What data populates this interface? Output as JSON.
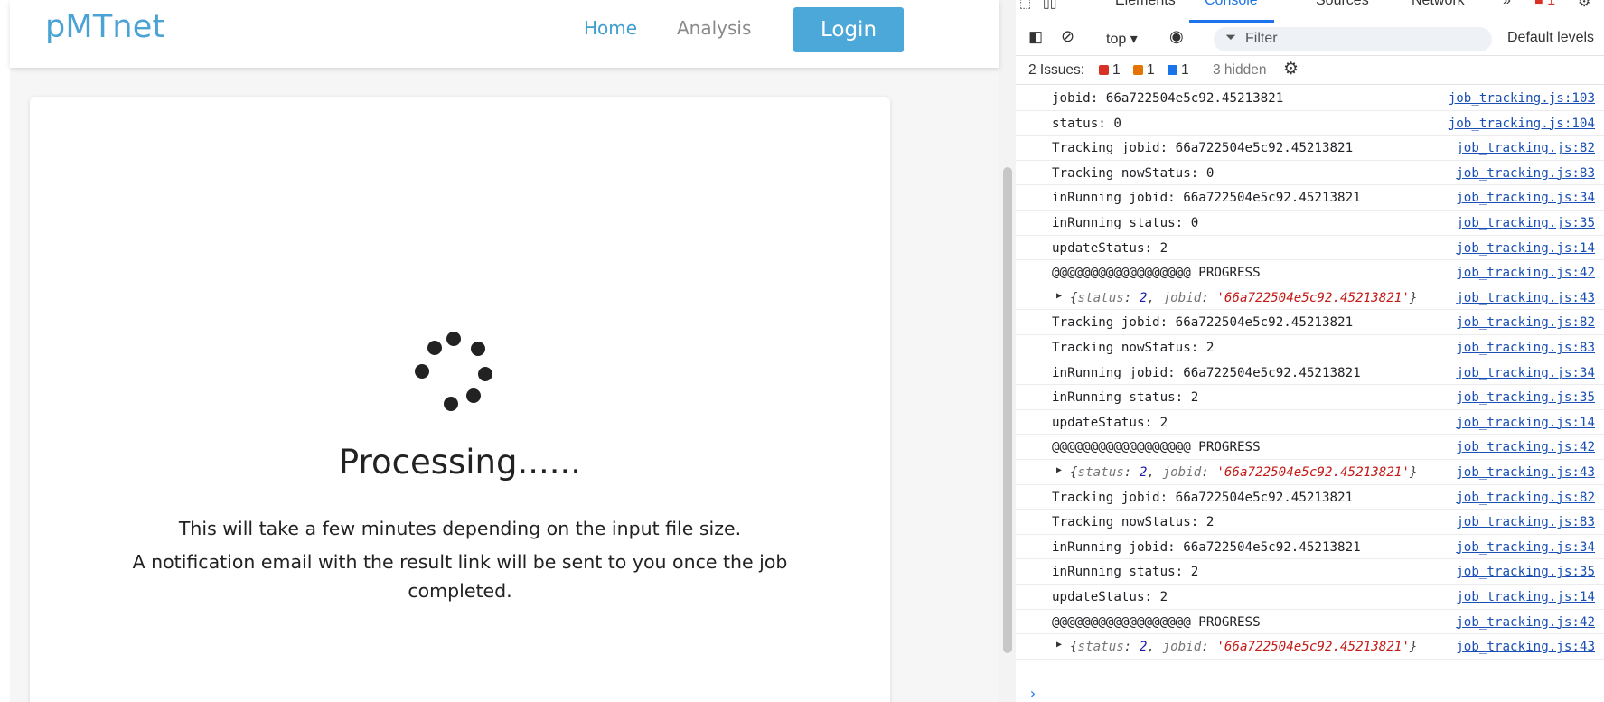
{
  "webpage": {
    "brand": "pMTnet",
    "nav": {
      "home": "Home",
      "analysis": "Analysis",
      "login": "Login"
    },
    "status_title": "Processing......",
    "message_line1": "This will take a few minutes depending on the input file size.",
    "message_line2": "A notification email with the result link will be sent to you once the job completed.",
    "colors": {
      "brand": "#4aa3d4",
      "login_bg": "#4ba8d8"
    }
  },
  "devtools": {
    "tabs": [
      "Elements",
      "Console",
      "Sources",
      "Network",
      "»"
    ],
    "active_tab": "Console",
    "toolbar": {
      "context": "top ▾",
      "filter_placeholder": "Filter",
      "levels": "Default levels"
    },
    "issues": {
      "label": "2 Issues:",
      "errors": "1",
      "warnings": "1",
      "info": "1",
      "hidden": "3 hidden"
    },
    "console_rows": [
      {
        "text": "jobid: 66a722504e5c92.45213821",
        "src": "job_tracking.js:103"
      },
      {
        "text": "status: 0",
        "src": "job_tracking.js:104"
      },
      {
        "text": "Tracking jobid: 66a722504e5c92.45213821",
        "src": "job_tracking.js:82"
      },
      {
        "text": "Tracking nowStatus: 0",
        "src": "job_tracking.js:83"
      },
      {
        "text": "inRunning jobid: 66a722504e5c92.45213821",
        "src": "job_tracking.js:34"
      },
      {
        "text": "inRunning status: 0",
        "src": "job_tracking.js:35"
      },
      {
        "text": "updateStatus: 2",
        "src": "job_tracking.js:14"
      },
      {
        "text": "@@@@@@@@@@@@@@@@@@ PROGRESS",
        "src": "job_tracking.js:42"
      },
      {
        "object": true,
        "status": "2",
        "jobid": "'66a722504e5c92.45213821'",
        "src": "job_tracking.js:43"
      },
      {
        "text": "Tracking jobid: 66a722504e5c92.45213821",
        "src": "job_tracking.js:82"
      },
      {
        "text": "Tracking nowStatus: 2",
        "src": "job_tracking.js:83"
      },
      {
        "text": "inRunning jobid: 66a722504e5c92.45213821",
        "src": "job_tracking.js:34"
      },
      {
        "text": "inRunning status: 2",
        "src": "job_tracking.js:35"
      },
      {
        "text": "updateStatus: 2",
        "src": "job_tracking.js:14"
      },
      {
        "text": "@@@@@@@@@@@@@@@@@@ PROGRESS",
        "src": "job_tracking.js:42"
      },
      {
        "object": true,
        "status": "2",
        "jobid": "'66a722504e5c92.45213821'",
        "src": "job_tracking.js:43"
      },
      {
        "text": "Tracking jobid: 66a722504e5c92.45213821",
        "src": "job_tracking.js:82"
      },
      {
        "text": "Tracking nowStatus: 2",
        "src": "job_tracking.js:83"
      },
      {
        "text": "inRunning jobid: 66a722504e5c92.45213821",
        "src": "job_tracking.js:34"
      },
      {
        "text": "inRunning status: 2",
        "src": "job_tracking.js:35"
      },
      {
        "text": "updateStatus: 2",
        "src": "job_tracking.js:14"
      },
      {
        "text": "@@@@@@@@@@@@@@@@@@ PROGRESS",
        "src": "job_tracking.js:42"
      },
      {
        "object": true,
        "status": "2",
        "jobid": "'66a722504e5c92.45213821'",
        "src": "job_tracking.js:43"
      }
    ],
    "prompt": "›",
    "colors": {
      "active_tab": "#1a73e8",
      "link": "#1a4fb5",
      "error": "#d93025",
      "warning": "#e37400",
      "info": "#1a73e8"
    }
  }
}
